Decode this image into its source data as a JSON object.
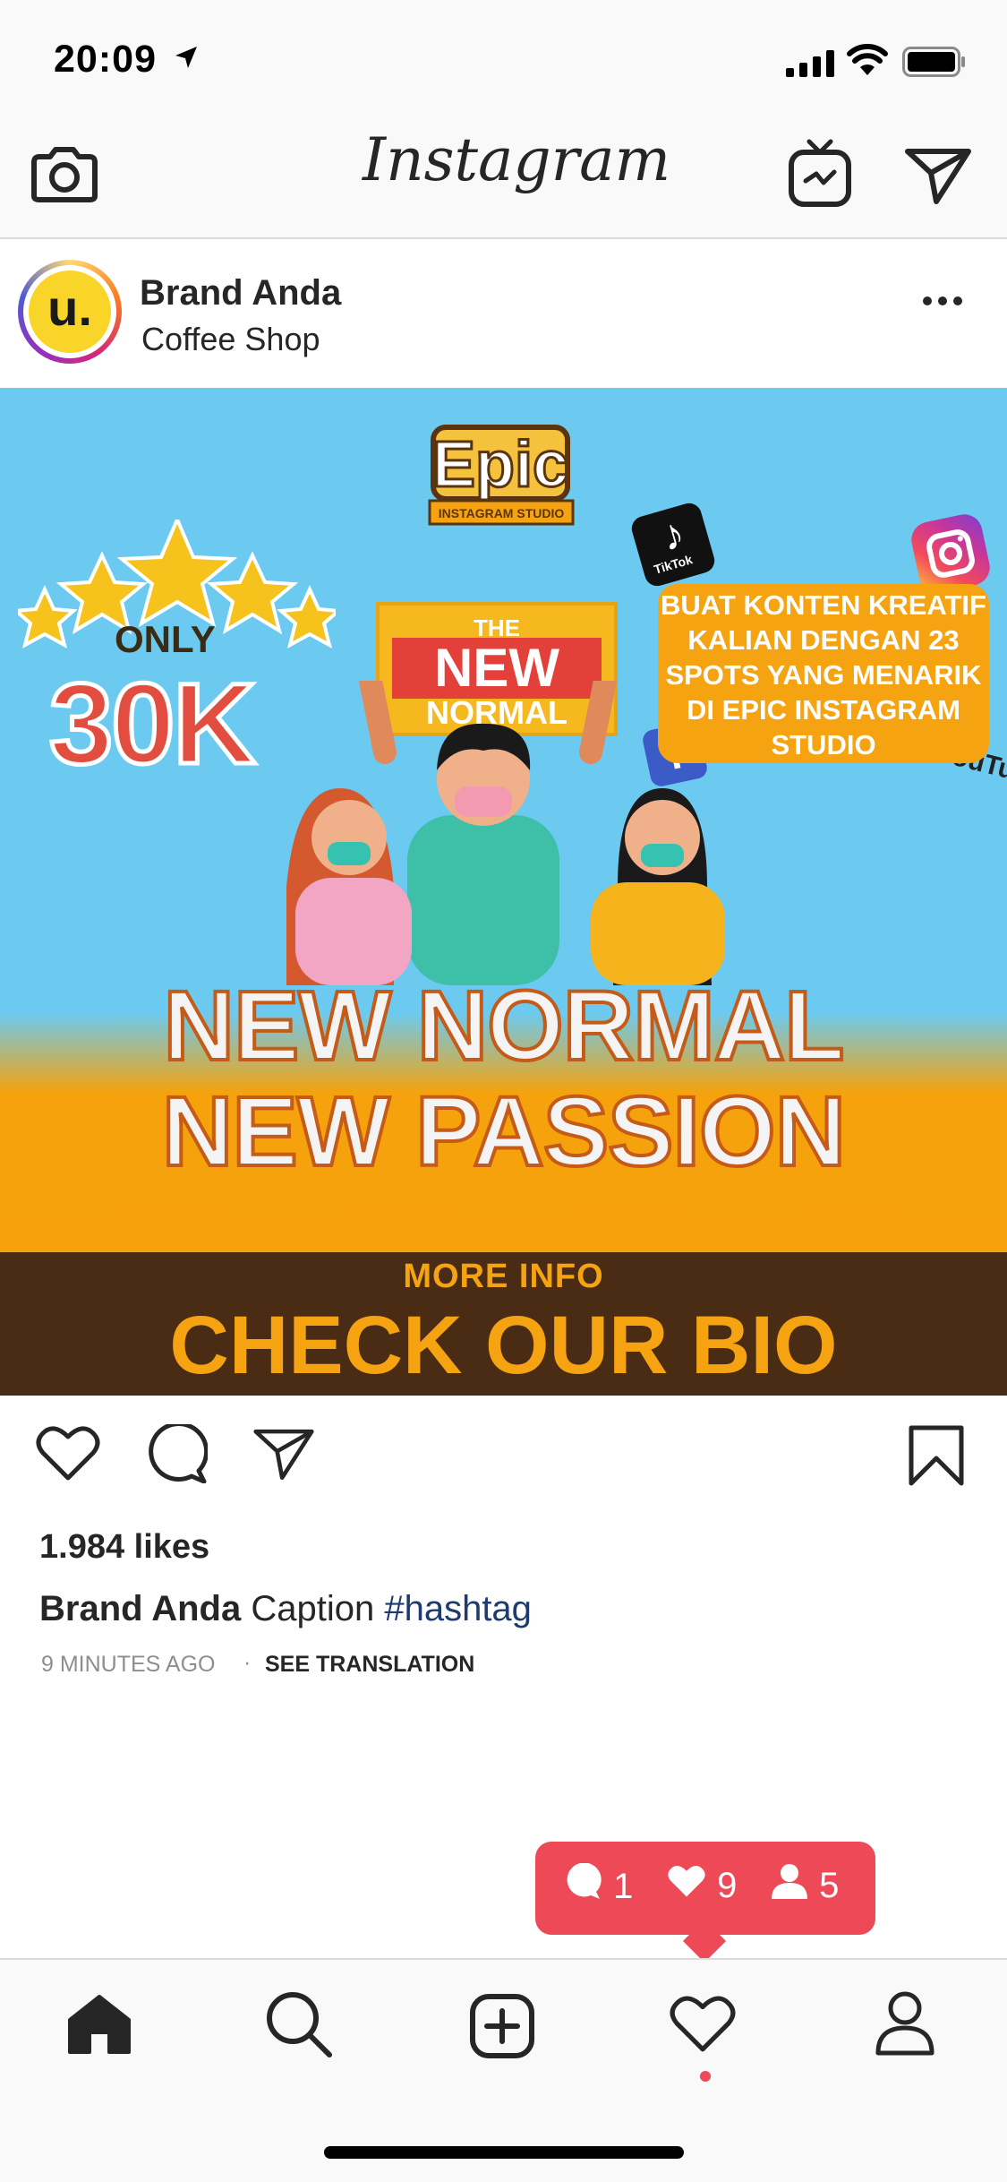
{
  "status_bar": {
    "time": "20:09",
    "icons": [
      "location-arrow-icon",
      "cellular-signal-icon",
      "wifi-icon",
      "battery-icon"
    ]
  },
  "nav_bar": {
    "logo_text": "Instagram",
    "icons": [
      "camera-icon",
      "igtv-icon",
      "direct-message-icon"
    ]
  },
  "post": {
    "username": "Brand Anda",
    "subtitle": "Coffee Shop",
    "avatar_letter": "u.",
    "avatar_color": "#f8d528",
    "image": {
      "logo_text": "Epic",
      "logo_subtext": "INSTAGRAM STUDIO",
      "price_prefix": "ONLY",
      "price": "30K",
      "sign_the": "THE",
      "sign_new": "NEW",
      "sign_normal": "NORMAL",
      "promo_text": "BUAT KONTEN KREATIF KALIAN DENGAN 23 SPOTS YANG MENARIK DI EPIC INSTAGRAM STUDIO",
      "tiktok_label": "TikTok",
      "youtube_label": "YouTube",
      "headline_line1": "NEW NORMAL",
      "headline_line2": "NEW PASSION",
      "more_info": "MORE INFO",
      "cta": "CHECK OUR BIO",
      "colors": {
        "sky": "#6ccaf0",
        "orange": "#f6a312",
        "band": "#4a2c15",
        "red": "#e24d3f"
      }
    },
    "likes_text": "1.984 likes",
    "caption": {
      "username": "Brand Anda",
      "text": "Caption",
      "hashtag": "#hashtag"
    },
    "time_ago": "9 MINUTES AGO",
    "separator": "·",
    "see_translation": "SEE TRANSLATION"
  },
  "activity_bubble": {
    "comments": "1",
    "likes": "9",
    "follows": "5",
    "color": "#ed4956"
  },
  "tab_bar": {
    "items": [
      "home-icon",
      "search-icon",
      "new-post-icon",
      "activity-icon",
      "profile-icon"
    ]
  }
}
